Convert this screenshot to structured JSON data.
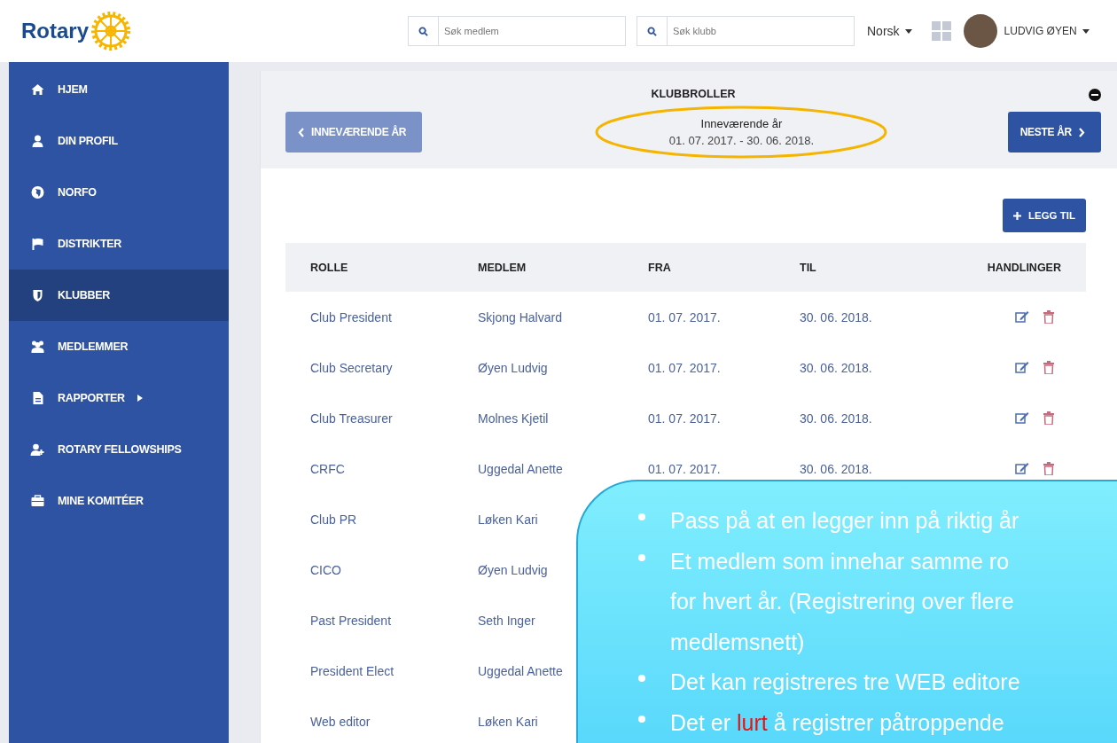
{
  "header": {
    "logo_text": "Rotary",
    "search_member": {
      "placeholder": "Søk medlem"
    },
    "search_club": {
      "placeholder": "Søk klubb"
    },
    "language": "Norsk",
    "user": "LUDVIG ØYEN"
  },
  "sidebar": {
    "items": [
      {
        "label": "HJEM",
        "selected": false,
        "submenu": false
      },
      {
        "label": "DIN PROFIL",
        "selected": false,
        "submenu": false
      },
      {
        "label": "NORFO",
        "selected": false,
        "submenu": false
      },
      {
        "label": "DISTRIKTER",
        "selected": false,
        "submenu": false
      },
      {
        "label": "KLUBBER",
        "selected": true,
        "submenu": false
      },
      {
        "label": "MEDLEMMER",
        "selected": false,
        "submenu": false
      },
      {
        "label": "RAPPORTER",
        "selected": false,
        "submenu": true
      },
      {
        "label": "ROTARY FELLOWSHIPS",
        "selected": false,
        "submenu": false
      },
      {
        "label": "MINE KOMITÉER",
        "selected": false,
        "submenu": false
      }
    ]
  },
  "panel": {
    "title": "KLUBBROLLER",
    "prev_button": {
      "label": "INNEVÆRENDE ÅR",
      "disabled": true
    },
    "period_label": "Inneværende år",
    "period": "01. 07. 2017. - 30. 06. 2018.",
    "next_button": {
      "label": "NESTE ÅR",
      "disabled": false
    },
    "add_button": "LEGG TIL"
  },
  "table": {
    "columns": [
      "ROLLE",
      "MEDLEM",
      "FRA",
      "TIL",
      "HANDLINGER"
    ],
    "rows": [
      {
        "rolle": "Club President",
        "medlem": "Skjong Halvard",
        "fra": "01. 07. 2017.",
        "til": "30. 06. 2018."
      },
      {
        "rolle": "Club Secretary",
        "medlem": "Øyen Ludvig",
        "fra": "01. 07. 2017.",
        "til": "30. 06. 2018."
      },
      {
        "rolle": "Club Treasurer",
        "medlem": "Molnes Kjetil",
        "fra": "01. 07. 2017.",
        "til": "30. 06. 2018."
      },
      {
        "rolle": "CRFC",
        "medlem": "Uggedal Anette",
        "fra": "01. 07. 2017.",
        "til": "30. 06. 2018."
      },
      {
        "rolle": "Club PR",
        "medlem": "Løken Kari"
      },
      {
        "rolle": "CICO",
        "medlem": "Øyen Ludvig"
      },
      {
        "rolle": "Past President",
        "medlem": "Seth Inger"
      },
      {
        "rolle": "President Elect",
        "medlem": "Uggedal Anette"
      },
      {
        "rolle": "Web editor",
        "medlem": "Løken Kari"
      }
    ]
  },
  "callout": {
    "bullets": [
      {
        "lines": [
          "Pass på at en legger inn på riktig år"
        ]
      },
      {
        "lines": [
          "Et medlem som innehar samme ro",
          "for hvert år. (Registrering over flere",
          "medlemsnett)"
        ]
      },
      {
        "lines": [
          "Det kan registreres tre WEB editore"
        ]
      },
      {
        "lines": [
          "Det er **lurt** å registrer påtroppende"
        ]
      }
    ]
  }
}
